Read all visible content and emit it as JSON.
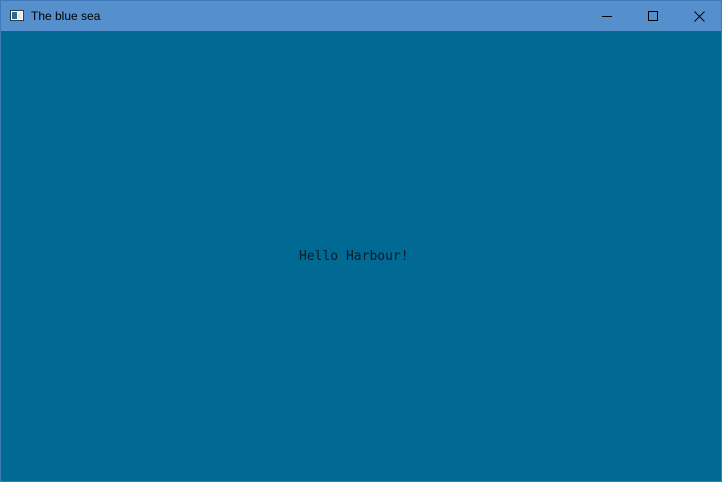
{
  "window": {
    "title": "The blue sea",
    "icons": {
      "app": "window-app-icon",
      "minimize": "minimize-icon",
      "maximize": "maximize-icon",
      "close": "close-icon"
    }
  },
  "content": {
    "message": "Hello Harbour!"
  },
  "colors": {
    "titlebar": "#5590cc",
    "client_background": "#006994",
    "text": "#0b1c26"
  }
}
